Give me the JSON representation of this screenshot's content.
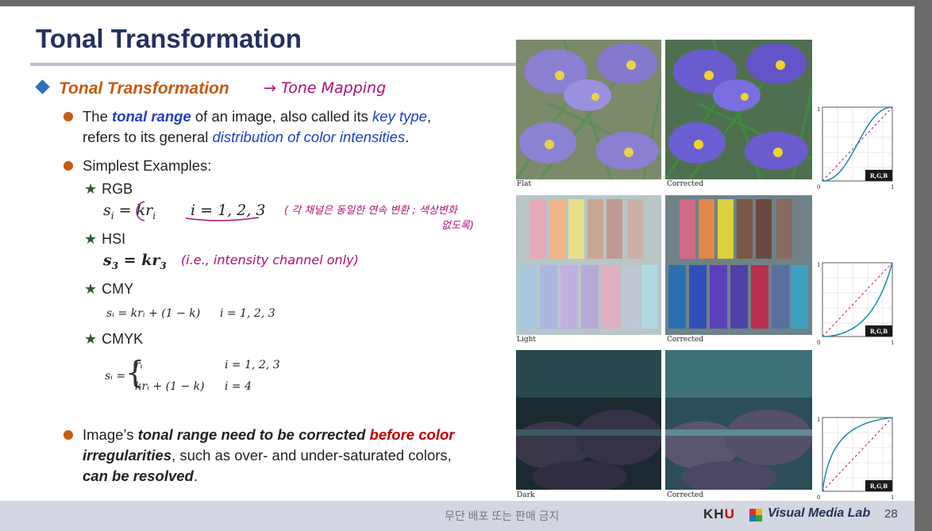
{
  "slide": {
    "title": "Tonal Transformation",
    "heading": "Tonal Transformation",
    "handwriting": {
      "tone_mapping": "→ Tone Mapping",
      "rgb_note_line1": "( 각 채널은 동일한 연속 변환 ; 색상변화",
      "rgb_note_line2": "없도록)",
      "hsi_note": "(i.e., intensity channel only)"
    },
    "bullets": {
      "b1": {
        "t1": "The ",
        "t2": "tonal range",
        "t3": " of an image, also called its ",
        "t4": "key type",
        "t5": ",",
        "t6": "refers to its general ",
        "t7": "distribution of color intensities",
        "t8": "."
      },
      "b2": "Simplest Examples:",
      "b3": {
        "t1": "Image’s ",
        "t2": "tonal range need to be corrected ",
        "t3": "before color",
        "t4": "irregularities",
        "t5": ", such as over- and under-saturated colors,",
        "t6": "can be resolved",
        "t7": "."
      }
    },
    "examples": [
      {
        "label": "RGB"
      },
      {
        "label": "HSI"
      },
      {
        "label": "CMY"
      },
      {
        "label": "CMYK"
      }
    ],
    "equations": {
      "rgb_lhs": "s",
      "rgb_sub": "i",
      "rgb_mid": " = kr",
      "rgb_sub2": "i",
      "rgb_idx": "i = 1, 2, 3",
      "hsi_lhs": "s",
      "hsi_sub": "3",
      "hsi_mid": " = kr",
      "hsi_sub2": "3",
      "cmy": "sᵢ = krᵢ + (1 − k)",
      "cmy_idx": "i = 1, 2, 3",
      "cmyk_lhs": "sᵢ =",
      "cmyk_r1": "rᵢ",
      "cmyk_r1_idx": "i = 1, 2, 3",
      "cmyk_r2": "krᵢ + (1 − k)",
      "cmyk_r2_idx": "i = 4"
    }
  },
  "figure": {
    "rows": [
      {
        "left_caption": "Flat",
        "right_caption": "Corrected"
      },
      {
        "left_caption": "Light",
        "right_caption": "Corrected"
      },
      {
        "left_caption": "Dark",
        "right_caption": "Corrected"
      }
    ],
    "plot": {
      "y_top": "1",
      "x_left": "0",
      "x_right": "1",
      "channel_label": "R,G,B"
    }
  },
  "footer": {
    "center": "무단 배포 또는 판매 금지",
    "khu_k": "KH",
    "khu_u": "U",
    "lab": "Visual Media Lab",
    "page": "28"
  },
  "colors": {
    "title": "#24305e",
    "heading": "#c55a11",
    "bullet_dot": "#c55a11",
    "emphasis_blue": "#1f3fc0",
    "emphasis_red": "#c00000",
    "handwriting": "#b0107a",
    "curve": "#1e8aa8"
  }
}
